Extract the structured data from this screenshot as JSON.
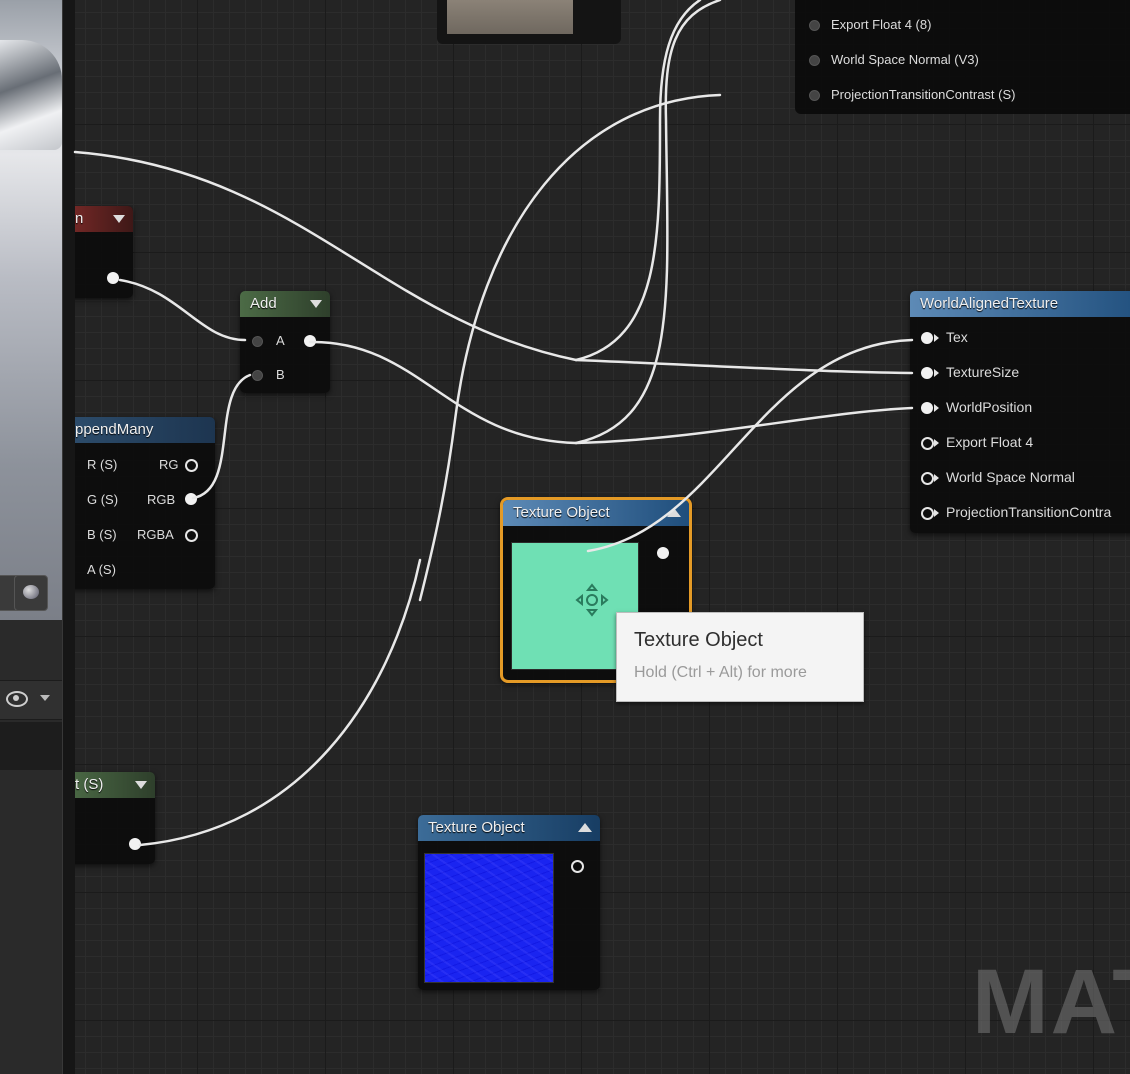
{
  "watermark": "MATE",
  "top_node": {
    "pins": [
      {
        "label": "Export Float 4 (8)"
      },
      {
        "label": "World Space Normal (V3)"
      },
      {
        "label": "ProjectionTransitionContrast (S)"
      }
    ]
  },
  "partial_red_node": {
    "title": "n"
  },
  "add_node": {
    "title": "Add",
    "pin_a": "A",
    "pin_b": "B"
  },
  "append_node": {
    "title": "ppendMany",
    "inputs": [
      "R (S)",
      "G (S)",
      "B (S)",
      "A (S)"
    ],
    "outputs": [
      "RG",
      "RGB",
      "RGBA"
    ]
  },
  "partial_param_node": {
    "title": "t (S)"
  },
  "texture_object_selected": {
    "title": "Texture Object",
    "preview_color": "#6fe0b4"
  },
  "tooltip": {
    "title": "Texture Object",
    "hint": "Hold (Ctrl + Alt) for more"
  },
  "texture_object_2": {
    "title": "Texture Object",
    "preview_color": "#1a24f0"
  },
  "world_aligned_texture": {
    "title": "WorldAlignedTexture",
    "inputs": [
      "Tex",
      "TextureSize",
      "WorldPosition"
    ],
    "outputs": [
      "Export Float 4",
      "World Space Normal",
      "ProjectionTransitionContra"
    ]
  },
  "colors": {
    "selection_border": "#e49a26",
    "graph_background": "#242424",
    "wire": "#e8e8e8"
  }
}
